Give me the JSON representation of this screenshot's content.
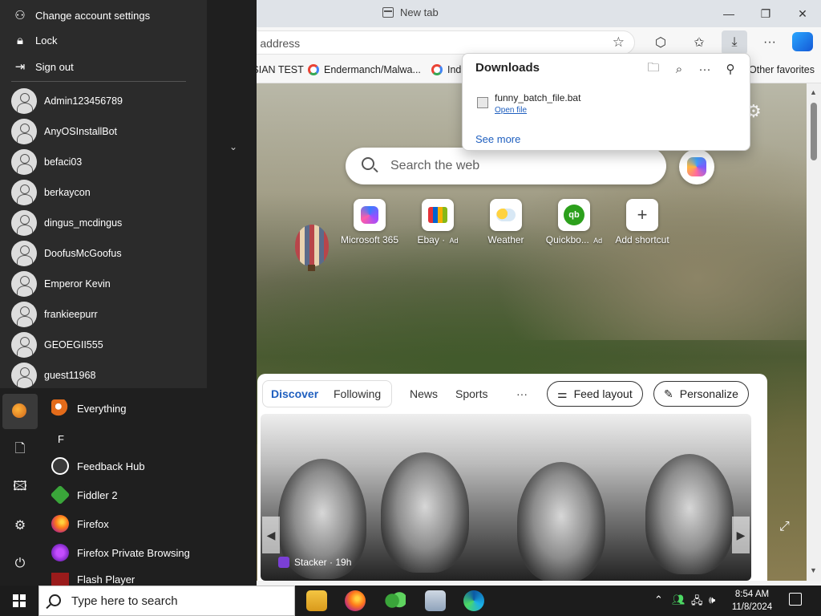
{
  "browser": {
    "tab_title": "New tab",
    "address_placeholder": "enter web address",
    "favorites": [
      "RUSSIAN TEST",
      "Endermanch/Malwa...",
      "Ind",
      "Other favorites"
    ]
  },
  "downloads": {
    "title": "Downloads",
    "file_name": "funny_batch_file.bat",
    "open_file": "Open file",
    "see_more": "See more"
  },
  "ntp": {
    "search_placeholder": "Search the web",
    "shortcuts": [
      {
        "label": "Microsoft 365",
        "ad": ""
      },
      {
        "label": "Ebay",
        "ad": "Ad"
      },
      {
        "label": "Weather",
        "ad": ""
      },
      {
        "label": "Quickbo...",
        "ad": "Ad"
      },
      {
        "label": "Add shortcut",
        "ad": ""
      }
    ]
  },
  "feed": {
    "tabs": [
      "Discover",
      "Following",
      "News",
      "Sports",
      "···"
    ],
    "feed_layout": "Feed layout",
    "personalize": "Personalize",
    "source": "Stacker · 19h"
  },
  "start_menu": {
    "user_menu": [
      "Change account settings",
      "Lock",
      "Sign out"
    ],
    "accounts": [
      "Admin123456789",
      "AnyOSInstallBot",
      "befaci03",
      "berkaycon",
      "dingus_mcdingus",
      "DoofusMcGoofus",
      "Emperor Kevin",
      "frankieepurr",
      "GEOEGII555",
      "guest11968"
    ],
    "apps": [
      {
        "label": "Everything",
        "color": "#e36b1a"
      },
      {
        "label": "Feedback Hub",
        "color": "#3a3a3a"
      },
      {
        "label": "Fiddler 2",
        "color": "#3aa53a"
      },
      {
        "label": "Firefox",
        "color": "#e8571c"
      },
      {
        "label": "Firefox Private Browsing",
        "color": "#8a2be2"
      },
      {
        "label": "Flash Player",
        "color": "#9a1b1b"
      }
    ],
    "letter_header": "F"
  },
  "taskbar": {
    "search_placeholder": "Type here to search",
    "time": "8:54 AM",
    "date": "11/8/2024"
  },
  "colors": {
    "accent": "#1f5fbf",
    "start_bg": "#1f1f1f",
    "taskbar_bg": "#1c1c1c"
  }
}
